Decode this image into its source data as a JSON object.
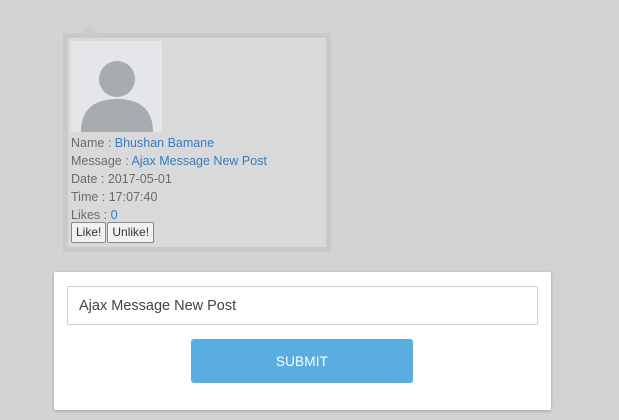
{
  "post": {
    "name_label": "Name : ",
    "name_value": "Bhushan Bamane",
    "message_label": "Message : ",
    "message_value": "Ajax Message New Post",
    "date_label": "Date : ",
    "date_value": "2017-05-01",
    "time_label": "Time : ",
    "time_value": "17:07:40",
    "likes_label": "Likes : ",
    "likes_value": "0",
    "like_button": "Like!",
    "unlike_button": "Unlike!",
    "avatar_icon": "user-silhouette-icon"
  },
  "compose": {
    "input_value": "Ajax Message New Post",
    "submit_label": "SUBMIT"
  },
  "colors": {
    "page_background": "#d3d3d3",
    "link": "#3a7ac2",
    "submit_button": "#5aade0"
  }
}
